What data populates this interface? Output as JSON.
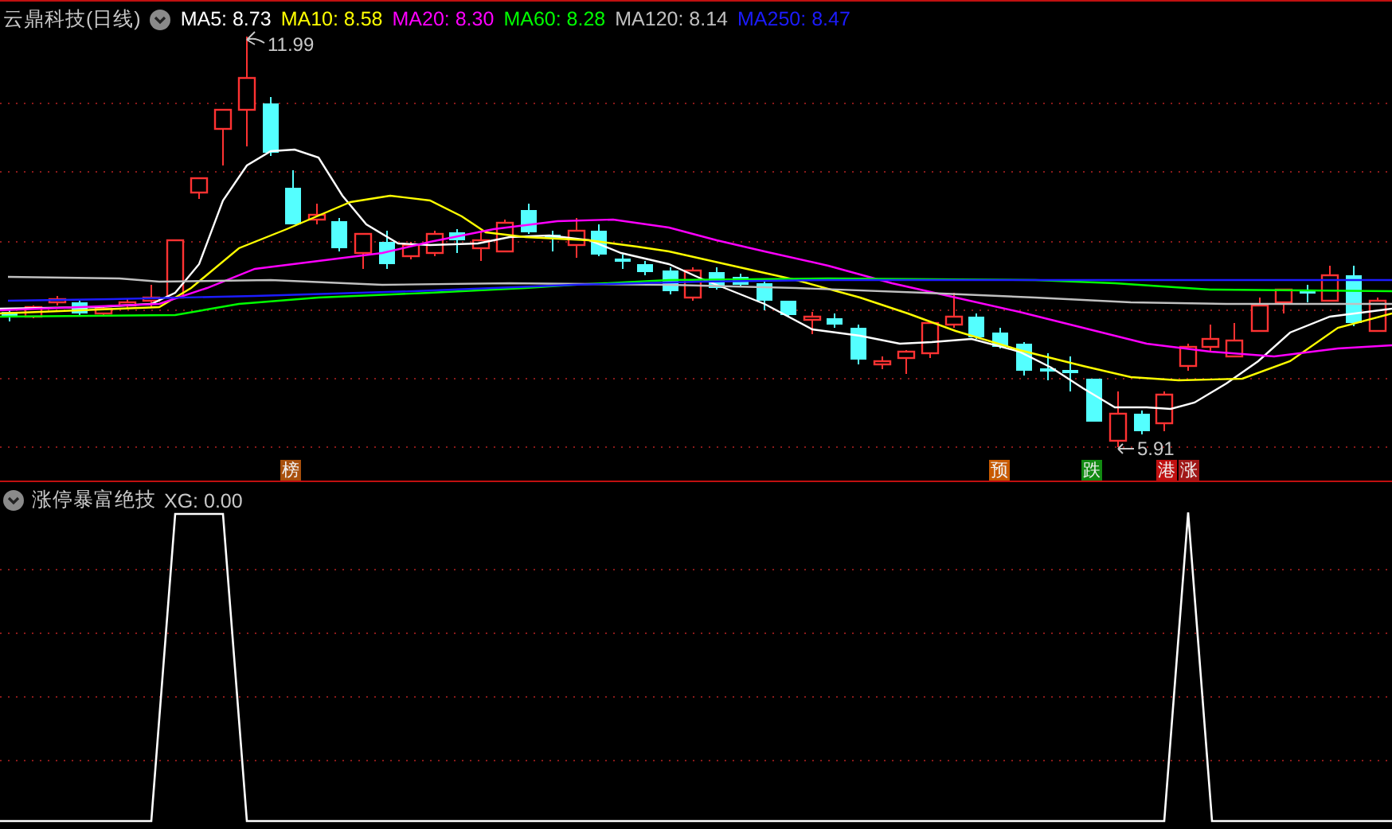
{
  "chart": {
    "title": "云鼎科技(日线)",
    "moving_averages": [
      {
        "label": "MA5: 8.73",
        "color": "#ffffff"
      },
      {
        "label": "MA10: 8.58",
        "color": "#ffff00"
      },
      {
        "label": "MA20: 8.30",
        "color": "#ff00ff"
      },
      {
        "label": "MA60: 8.28",
        "color": "#00ff00"
      },
      {
        "label": "MA120: 8.14",
        "color": "#c0c0c0"
      },
      {
        "label": "MA250: 8.47",
        "color": "#1c1cff"
      }
    ],
    "high_label": "11.99",
    "low_label": "5.91",
    "markers": [
      {
        "text": "榜",
        "color": "#a8500c"
      },
      {
        "text": "预",
        "color": "#c85a00"
      },
      {
        "text": "跌",
        "color": "#128a12"
      },
      {
        "text": "港",
        "color": "#c01010"
      },
      {
        "text": "涨",
        "color": "#a01818"
      }
    ]
  },
  "indicator": {
    "title": "涨停暴富绝技",
    "reading": "XG: 0.00"
  }
}
